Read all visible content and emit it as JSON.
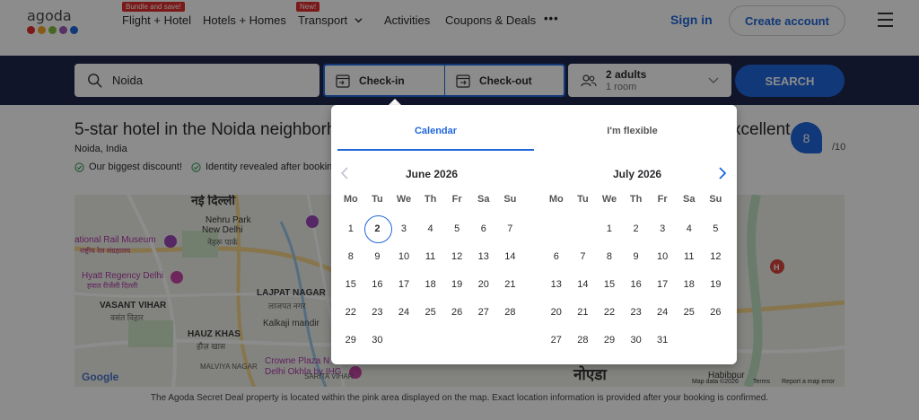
{
  "header": {
    "logo_text": "agoda",
    "logo_colors": [
      "#e12d2d",
      "#f5a623",
      "#7ebd3d",
      "#9b59b6",
      "#2067da"
    ],
    "nav": [
      {
        "label": "Flight + Hotel",
        "badge": "Bundle and save!"
      },
      {
        "label": "Hotels + Homes",
        "badge": ""
      },
      {
        "label": "Transport",
        "badge": "New!"
      },
      {
        "label": "Activities",
        "badge": ""
      },
      {
        "label": "Coupons & Deals",
        "badge": ""
      }
    ],
    "more": "•••",
    "sign_in": "Sign in",
    "create_account": "Create account"
  },
  "search": {
    "destination": "Noida",
    "check_in": "Check-in",
    "check_out": "Check-out",
    "guests_line1": "2 adults",
    "guests_line2": "1 room",
    "button": "SEARCH"
  },
  "listing": {
    "title": "5-star hotel in the Noida neighborh",
    "title_right": "xcellent",
    "location": "Noida, India",
    "perks": [
      "Our biggest discount!",
      "Identity revealed after bookin"
    ],
    "score": "8",
    "score_of": "/10",
    "map_note": "The Agoda Secret Deal property is located within the pink area displayed on the map. Exact location information is provided after your booking is confirmed.",
    "map_labels": {
      "l1": "नई दिल्ली",
      "l2": "Nehru Park",
      "l3": "New Delhi",
      "l4": "नेहरू पार्क",
      "l5": "ational Rail Museum",
      "l6": "राष्ट्रीय रेल संग्रहालय",
      "l7": "Hyatt Regency Delhi",
      "l8": "हयात रीजेंसी दिल्ली",
      "l9": "LAJPAT NAGAR",
      "l10": "लाजपत नगर",
      "l11": "VASANT VIHAR",
      "l12": "वसंत विहार",
      "l13": "Kalkaji mandir",
      "l14": "HAUZ KHAS",
      "l15": "हौज़ खास",
      "l16": "MALVIYA NAGAR",
      "l17": "Crowne Plaza N",
      "l18": "Delhi Okhla by IHG",
      "l19": "SARITA VIHAR",
      "l20": "नोएडा",
      "l21": "Habibpur",
      "google": "Google",
      "map_data": "Map data ©2026",
      "terms": "Terms",
      "report": "Report a map error"
    }
  },
  "calendar": {
    "tabs": [
      "Calendar",
      "I'm flexible"
    ],
    "weekdays": [
      "Mo",
      "Tu",
      "We",
      "Th",
      "Fr",
      "Sa",
      "Su"
    ],
    "months": [
      {
        "title": "June 2026",
        "leading_blanks": 0,
        "days": [
          "1",
          "2",
          "3",
          "4",
          "5",
          "6",
          "7",
          "8",
          "9",
          "10",
          "11",
          "12",
          "13",
          "14",
          "15",
          "16",
          "17",
          "18",
          "19",
          "20",
          "21",
          "22",
          "23",
          "24",
          "25",
          "26",
          "27",
          "28",
          "29",
          "30"
        ],
        "selected": "2"
      },
      {
        "title": "July 2026",
        "leading_blanks": 2,
        "days": [
          "1",
          "2",
          "3",
          "4",
          "5",
          "6",
          "7",
          "8",
          "9",
          "10",
          "11",
          "12",
          "13",
          "14",
          "15",
          "16",
          "17",
          "18",
          "19",
          "20",
          "21",
          "22",
          "23",
          "24",
          "25",
          "26",
          "27",
          "28",
          "29",
          "30",
          "31"
        ],
        "selected": ""
      }
    ]
  }
}
